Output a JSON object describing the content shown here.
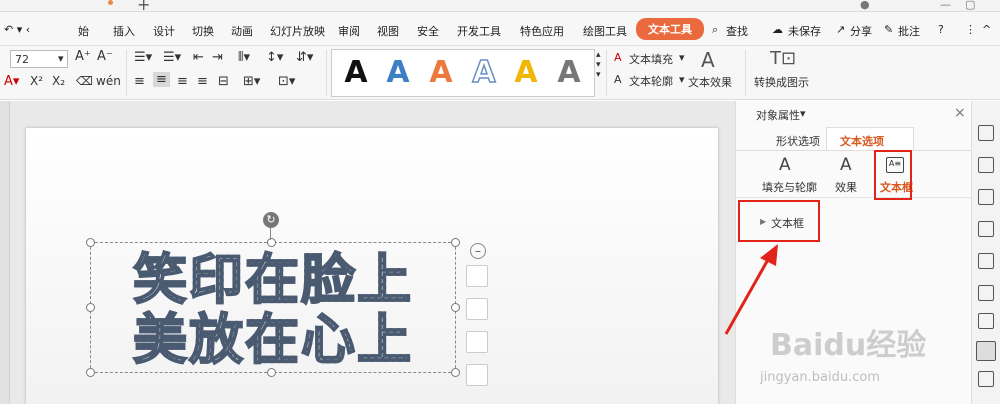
{
  "titlebar": {
    "new_tab": "+",
    "min": "—",
    "restore": "▢"
  },
  "menu": {
    "items": [
      {
        "label": "始",
        "name": "menu-start"
      },
      {
        "label": "插入",
        "name": "menu-insert"
      },
      {
        "label": "设计",
        "name": "menu-design"
      },
      {
        "label": "切换",
        "name": "menu-transition"
      },
      {
        "label": "动画",
        "name": "menu-animation"
      },
      {
        "label": "幻灯片放映",
        "name": "menu-slideshow"
      },
      {
        "label": "审阅",
        "name": "menu-review"
      },
      {
        "label": "视图",
        "name": "menu-view"
      },
      {
        "label": "安全",
        "name": "menu-security"
      },
      {
        "label": "开发工具",
        "name": "menu-devtools"
      },
      {
        "label": "特色应用",
        "name": "menu-features"
      },
      {
        "label": "绘图工具",
        "name": "menu-drawing-tools"
      }
    ],
    "active_tab": "文本工具",
    "search": "查找",
    "unsaved": "未保存",
    "share": "分享",
    "comment": "批注",
    "help": "?"
  },
  "ribbon": {
    "font_size": "72",
    "text_fill": "文本填充",
    "text_outline": "文本轮廓",
    "text_effect": "文本效果",
    "convert_graphic": "转换成图示",
    "gallery_letters": [
      "A",
      "A",
      "A",
      "A",
      "A",
      "A"
    ],
    "gallery_colors": [
      "#111111",
      "#3d7fc4",
      "#ec7a3c",
      "#6b8fc4",
      "#f2b705",
      "#777777"
    ]
  },
  "slide": {
    "line1": "笑印在脸上",
    "line2": "美放在心上"
  },
  "panel": {
    "title": "对象属性",
    "tab_shape": "形状选项",
    "tab_text": "文本选项",
    "sub_fill": "填充与轮廓",
    "sub_effect": "效果",
    "sub_textbox": "文本框",
    "section_textbox": "文本框",
    "close": "×"
  },
  "watermark": {
    "brand": "Baidu经验",
    "url": "jingyan.baidu.com"
  },
  "colors": {
    "accent": "#ea6a3d",
    "highlight": "#e2231a",
    "panel_active": "#d9581f"
  }
}
